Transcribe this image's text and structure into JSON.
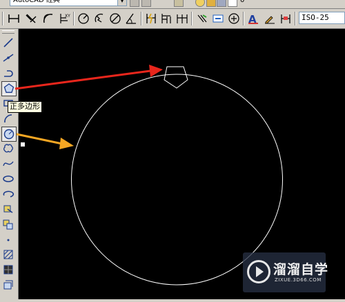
{
  "workspace_select": {
    "value": "AutoCAD 经典"
  },
  "layer_value": "0",
  "dim_style_select": {
    "value": "ISO-25"
  },
  "tooltip": {
    "text": "正多边形"
  },
  "watermark": {
    "brand": "溜溜自学",
    "url": "ZIXUE.3D66.COM"
  },
  "colors": {
    "canvas": "#000000",
    "drawing": "#ffffff",
    "arrow_red": "#e8261c",
    "arrow_orange": "#f5a623"
  },
  "top_toolbar_icons": [
    "linear-dimension",
    "aligned-dimension",
    "arc-length",
    "ordinate",
    "radius",
    "jogged",
    "diameter",
    "angular",
    "quick-dimension",
    "baseline",
    "continue",
    "dimension-space",
    "dimension-break",
    "tolerance",
    "center-mark",
    "inspection",
    "jogged-linear",
    "dimension-edit",
    "dimension-text-edit",
    "dimension-update",
    "dim-style"
  ],
  "left_toolbar_icons": [
    "line",
    "construction-line",
    "polyline",
    "polygon",
    "rectangle",
    "arc",
    "circle",
    "revision-cloud",
    "spline",
    "ellipse",
    "ellipse-arc",
    "insert-block",
    "make-block",
    "point",
    "hatch",
    "gradient",
    "region",
    "table",
    "multiline-text"
  ]
}
